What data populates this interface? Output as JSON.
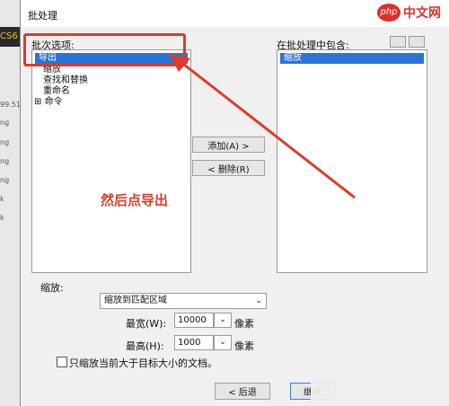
{
  "background_app": {
    "label": "CS6",
    "rows": [
      "99.51.",
      "ng",
      "ng",
      "ng",
      "ng",
      "k",
      "k"
    ]
  },
  "dialog": {
    "title": "批处理",
    "watermark": "php 中文网",
    "batch_options": {
      "label": "批次选项:",
      "items": [
        "导出",
        "缩放",
        "查找和替换",
        "重命名",
        "命令"
      ],
      "expand_glyph": "⊞",
      "selected_index": 0
    },
    "included": {
      "label": "在批处理中包含:",
      "items": [
        "缩放"
      ]
    },
    "add_button": "添加(A) >",
    "remove_button": "< 删除(R)",
    "scale": {
      "label": "缩放:",
      "mode": "缩放到匹配区域",
      "max_width_label": "最宽(W):",
      "max_width_value": "10000",
      "max_height_label": "最高(H):",
      "max_height_value": "1000",
      "unit": "像素",
      "checkbox_label": "只缩放当前大于目标大小的文档。",
      "checkbox_checked": false
    },
    "back_button": "< 后退",
    "next_button": "继续"
  },
  "annotation": {
    "text": "然后点导出",
    "color": "#e03a2a"
  },
  "colors": {
    "selection": "#2a74d8",
    "dialog_bg": "#f0f0f0"
  }
}
